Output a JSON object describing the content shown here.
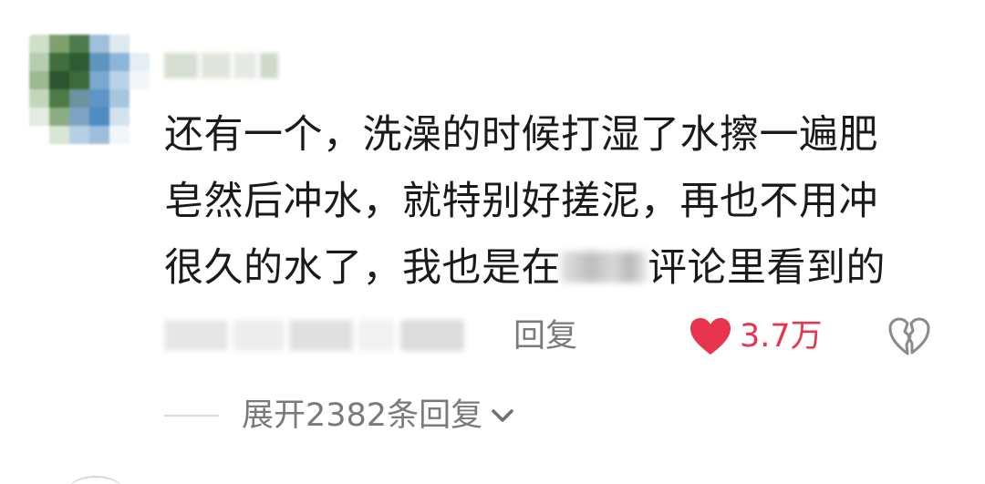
{
  "comment": {
    "text_line1": "还有一个，洗澡的时候打湿了水擦一遍肥",
    "text_line2": "皂然后冲水，就特别好搓泥，再也不用冲",
    "text_line3_before": "很久的水了，我也是在",
    "text_line3_after": "评论里看到的",
    "reply_label": "回复",
    "likes": "3.7万",
    "expand_label": "展开2382条回复"
  },
  "colors": {
    "like_red": "#e8344e",
    "secondary_text": "#7a7a7a",
    "primary_text": "#1a1a1a"
  },
  "icons": {
    "like": "heart-icon",
    "dislike": "broken-heart-icon",
    "expand": "chevron-down-icon"
  }
}
